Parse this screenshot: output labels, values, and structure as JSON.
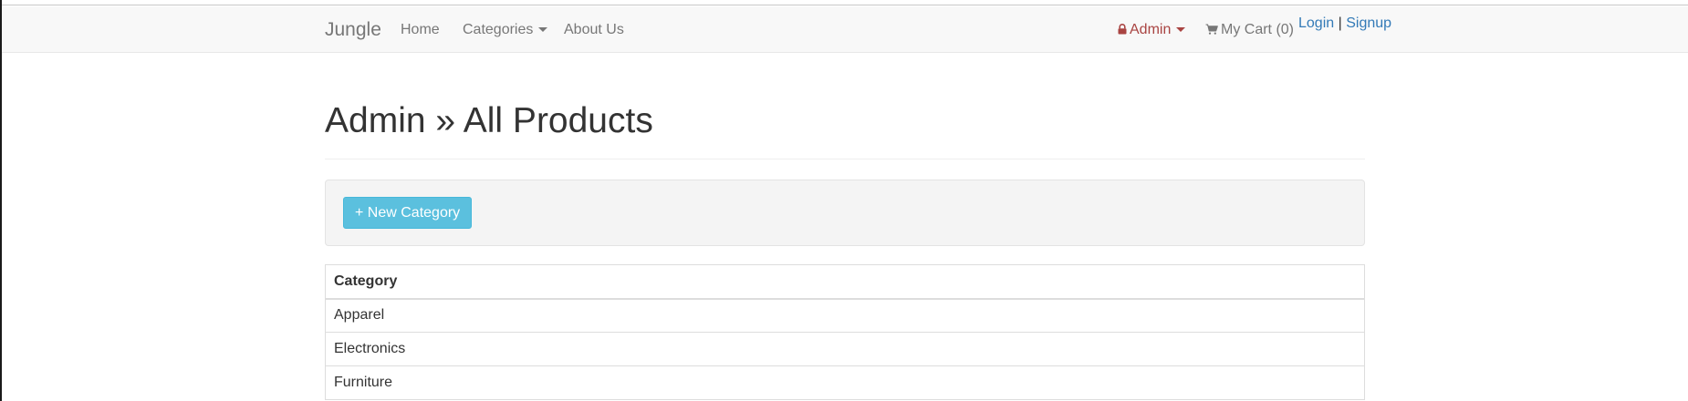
{
  "navbar": {
    "brand": "Jungle",
    "home": "Home",
    "categories": "Categories",
    "about": "About Us",
    "admin": "Admin",
    "cart": "My Cart (0)",
    "login": "Login",
    "separator": "|",
    "signup": "Signup",
    "icons": {
      "admin": "lock-icon",
      "cart": "shopping-cart-icon",
      "dropdown": "caret-down-icon"
    }
  },
  "page": {
    "title": "Admin » All Products"
  },
  "toolbar": {
    "new_category": "+ New Category"
  },
  "table": {
    "header": "Category",
    "rows": [
      "Apparel",
      "Electronics",
      "Furniture"
    ]
  },
  "colors": {
    "admin_text": "#a94442",
    "link": "#337ab7",
    "info_button": "#5bc0de"
  }
}
